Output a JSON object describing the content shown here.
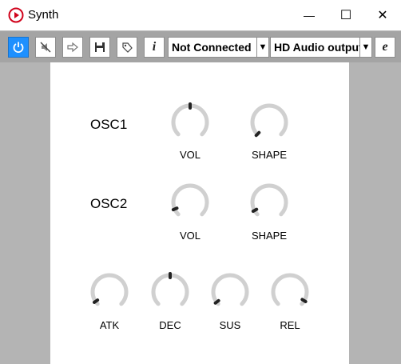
{
  "window": {
    "title": "Synth",
    "min_glyph": "—",
    "max_glyph": "☐",
    "close_glyph": "✕"
  },
  "toolbar": {
    "midi_device": "Not Connected",
    "audio_device": "HD Audio output",
    "info_label": "i",
    "edit_label": "e",
    "dropdown_glyph": "▼"
  },
  "osc1": {
    "label": "OSC1",
    "vol_label": "VOL",
    "shape_label": "SHAPE",
    "vol_value": 0.5,
    "shape_value": 0.0
  },
  "osc2": {
    "label": "OSC2",
    "vol_label": "VOL",
    "shape_label": "SHAPE",
    "vol_value": 0.08,
    "shape_value": 0.06
  },
  "envelope": {
    "atk_label": "ATK",
    "dec_label": "DEC",
    "sus_label": "SUS",
    "rel_label": "REL",
    "atk_value": 0.04,
    "dec_value": 0.5,
    "sus_value": 0.03,
    "rel_value": 0.95
  },
  "colors": {
    "accent": "#1e90ff",
    "knob_track": "#d0d0d0",
    "knob_pointer": "#222222",
    "side": "#b4b4b4"
  }
}
